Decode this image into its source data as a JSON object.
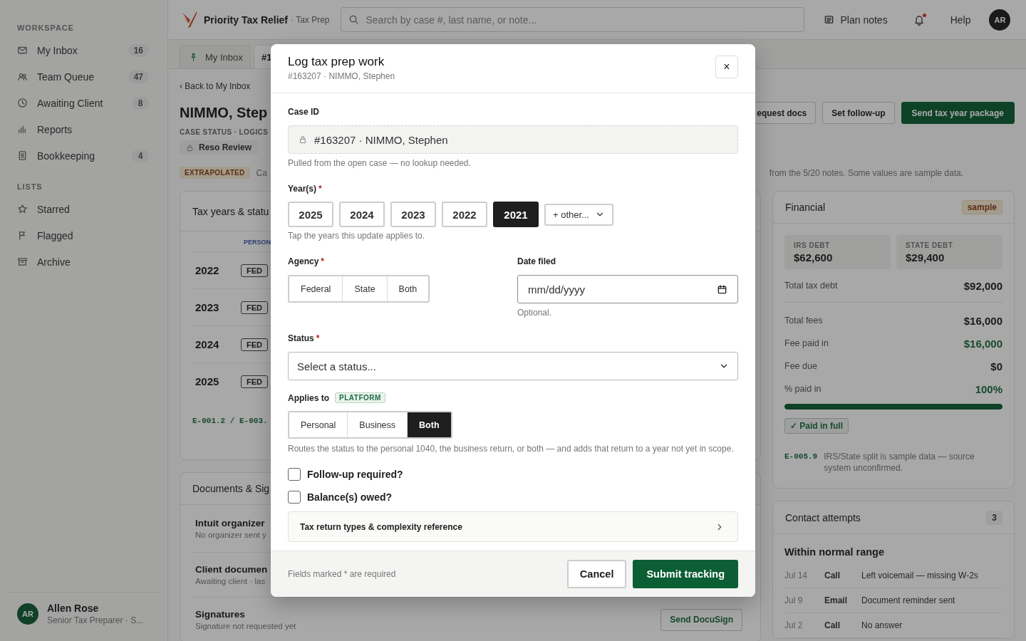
{
  "sidebar": {
    "sections": [
      {
        "title": "WORKSPACE",
        "items": [
          {
            "label": "My Inbox",
            "count": "16",
            "selected": false
          },
          {
            "label": "Team Queue",
            "count": "47",
            "selected": false
          },
          {
            "label": "Awaiting Client",
            "count": "8",
            "selected": false
          },
          {
            "label": "Reports",
            "selected": false
          },
          {
            "label": "Bookkeeping",
            "count": "4",
            "selected": false
          }
        ]
      },
      {
        "title": "LISTS",
        "items": [
          {
            "label": "Starred",
            "selected": false
          },
          {
            "label": "Flagged",
            "selected": false
          },
          {
            "label": "Archive",
            "selected": false
          }
        ]
      }
    ],
    "user": {
      "initials": "AR",
      "name": "Allen Rose",
      "role": "Senior Tax Preparer · S..."
    }
  },
  "header": {
    "brand": "Priority Tax Relief",
    "product": "· Tax Prep",
    "search": {
      "placeholder": "Search by case #, last name, or note..."
    },
    "plan_notes": "Plan notes",
    "notifications": {
      "unread": true
    },
    "help": "Help",
    "avatar": "AR"
  },
  "tabs": [
    {
      "label": "My Inbox",
      "pinned": true,
      "selected": false
    },
    {
      "label": "#1",
      "pinned": false,
      "selected": true
    }
  ],
  "case": {
    "back": "‹ Back to My Inbox",
    "title": "NIMMO, Step",
    "actions": [
      {
        "label": "equest docs",
        "kind": "secondary"
      },
      {
        "label": "Set follow-up",
        "kind": "secondary"
      },
      {
        "label": "Send tax year package",
        "kind": "primary"
      }
    ],
    "status_label": "CASE STATUS · LOGICS",
    "status_chip": "Reso Review",
    "notice": {
      "badge": "EXTRAPOLATED",
      "text_left": "Ca",
      "text_right": "from the 5/20 notes. Some values are sample data."
    }
  },
  "tax_years": {
    "title": "Tax years & statu",
    "column": "PERSON",
    "rows": [
      {
        "year": "2022",
        "agency": "FED"
      },
      {
        "year": "2023",
        "agency": "FED"
      },
      {
        "year": "2024",
        "agency": "FED"
      },
      {
        "year": "2025",
        "agency": "FED"
      }
    ],
    "footnote": "E-001.2 / E-003."
  },
  "documents": {
    "title": "Documents & Sig",
    "items": [
      {
        "title": "Intuit organizer",
        "detail": "No organizer sent y"
      },
      {
        "title": "Client documen",
        "detail": "Awaiting client · las"
      },
      {
        "title": "Signatures",
        "detail": "Signature not requested yet",
        "action": "Send DocuSign"
      }
    ]
  },
  "financial": {
    "title": "Financial",
    "badge": "sample",
    "tiles": [
      {
        "label": "IRS DEBT",
        "value": "$62,600"
      },
      {
        "label": "STATE DEBT",
        "value": "$29,400"
      }
    ],
    "total": {
      "label": "Total tax debt",
      "value": "$92,000"
    },
    "rows": [
      {
        "label": "Total fees",
        "value": "$16,000",
        "positive": false
      },
      {
        "label": "Fee paid in",
        "value": "$16,000",
        "positive": true
      },
      {
        "label": "Fee due",
        "value": "$0",
        "positive": false
      },
      {
        "label": "% paid in",
        "value": "100%",
        "positive": true
      }
    ],
    "progress": {
      "level": 1
    },
    "status": "✓ Paid in full",
    "note": {
      "code": "E-005.9",
      "text": "IRS/State split is sample data — source system unconfirmed."
    }
  },
  "contacts": {
    "title": "Contact attempts",
    "count": "3",
    "group": "Within normal range",
    "rows": [
      {
        "date": "Jul 14",
        "channel": "Call",
        "note": "Left voicemail — missing W-2s"
      },
      {
        "date": "Jul 9",
        "channel": "Email",
        "note": "Document reminder sent"
      },
      {
        "date": "Jul 2",
        "channel": "Call",
        "note": "No answer"
      }
    ]
  },
  "modal": {
    "title": "Log tax prep work",
    "subtitle": "#163207 · NIMMO, Stephen",
    "close": "×",
    "case_id": {
      "label": "Case ID",
      "value": "#163207 · NIMMO, Stephen",
      "hint": "Pulled from the open case — no lookup needed."
    },
    "years": {
      "label": "Year(s)",
      "required_mark": "*",
      "options": [
        {
          "label": "2025",
          "selected": false
        },
        {
          "label": "2024",
          "selected": false
        },
        {
          "label": "2023",
          "selected": false
        },
        {
          "label": "2022",
          "selected": false
        },
        {
          "label": "2021",
          "selected": true
        }
      ],
      "other": "+ other...",
      "hint": "Tap the years this update applies to."
    },
    "agency": {
      "label": "Agency",
      "required_mark": "*",
      "options": [
        {
          "label": "Federal",
          "selected": false
        },
        {
          "label": "State",
          "selected": false
        },
        {
          "label": "Both",
          "selected": false
        }
      ]
    },
    "date_filed": {
      "label": "Date filed",
      "placeholder": "mm/dd/yyyy",
      "hint": "Optional."
    },
    "status": {
      "label": "Status",
      "required_mark": "*",
      "placeholder": "Select a status..."
    },
    "applies_to": {
      "label": "Applies to",
      "badge": "PLATFORM",
      "options": [
        {
          "label": "Personal",
          "selected": false
        },
        {
          "label": "Business",
          "selected": false
        },
        {
          "label": "Both",
          "selected": true
        }
      ],
      "hint": "Routes the status to the personal 1040, the business return, or both — and adds that return to a year not yet in scope."
    },
    "checks": [
      {
        "label": "Follow-up required?",
        "checked": false
      },
      {
        "label": "Balance(s) owed?",
        "checked": false
      }
    ],
    "reference": {
      "label": "Tax return types & complexity reference",
      "expanded": false
    },
    "footer_note": "Fields marked * are required",
    "buttons": [
      {
        "label": "Cancel",
        "kind": "secondary"
      },
      {
        "label": "Submit tracking",
        "kind": "primary"
      }
    ]
  }
}
